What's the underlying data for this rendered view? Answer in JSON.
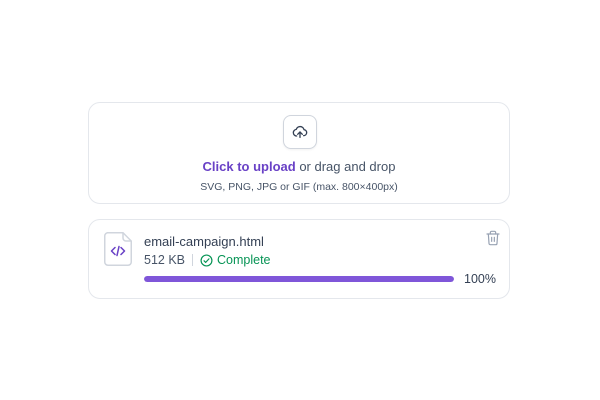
{
  "uploader": {
    "upload_icon": "upload-cloud-icon",
    "link_text": "Click to upload",
    "rest_text": " or drag and drop",
    "hint": "SVG, PNG, JPG or GIF (max. 800×400px)"
  },
  "file": {
    "icon": "html-file-code-icon",
    "name": "email-campaign.html",
    "size": "512 KB",
    "status": "Complete",
    "status_icon": "check-circle-icon",
    "progress": 100,
    "progress_label": "100%",
    "delete_icon": "trash-icon"
  },
  "colors": {
    "accent": "#7f56d9",
    "link": "#6941c6",
    "success": "#079455",
    "border": "#e4e7ec",
    "track": "#eaecf0"
  }
}
